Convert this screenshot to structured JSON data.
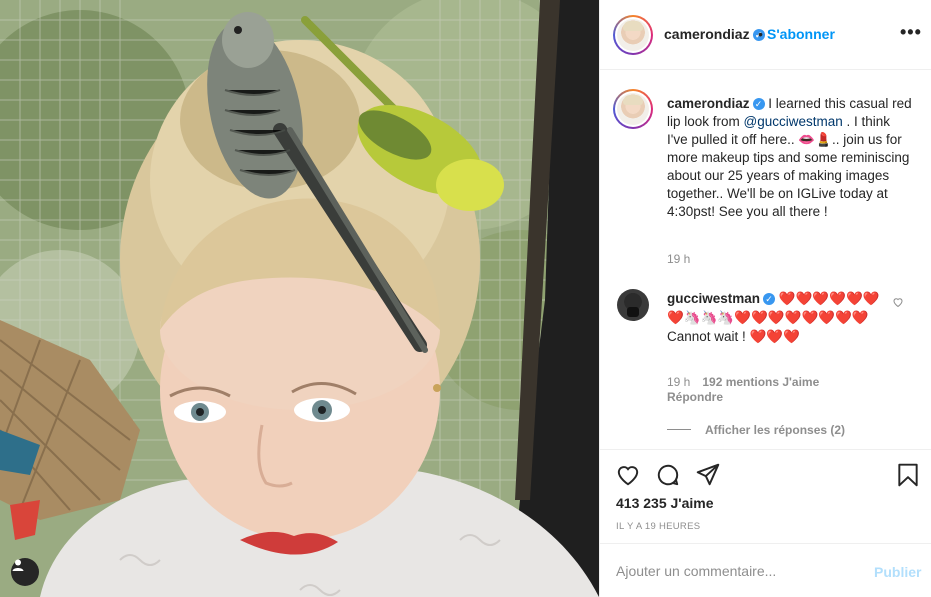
{
  "post": {
    "username": "camerondiaz",
    "follow_label": "S'abonner",
    "dot": "•",
    "more_label": "•••"
  },
  "caption": {
    "username": "camerondiaz",
    "text_before_mention": "I learned this casual red lip look from ",
    "mention": "@gucciwestman",
    "text_after_mention": " . I think I've pulled it off here.. 👄💄.. join us for more makeup tips and some reminiscing about our 25 years of making images together.. We'll be on IGLive today at 4:30pst! See you all there !",
    "time": "19 h"
  },
  "reply": {
    "username": "gucciwestman",
    "emoji_line": "❤️❤️❤️❤️❤️❤️❤️🦄🦄🦄❤️❤️❤️❤️❤️❤️❤️❤️",
    "text": "Cannot wait ! ❤️❤️❤️",
    "time": "19 h",
    "likes": "192 mentions J'aime",
    "reply_label": "Répondre",
    "view_replies": "Afficher les réponses (2)"
  },
  "actions": {
    "likes_count": "413 235 J'aime",
    "posted_ago": "IL Y A 19 HEURES"
  },
  "comment_box": {
    "placeholder": "Ajouter un commentaire...",
    "publish_label": "Publier"
  },
  "colors": {
    "accent": "#0095f6",
    "publish_disabled": "#b2dffc",
    "verified": "#3897f0"
  }
}
